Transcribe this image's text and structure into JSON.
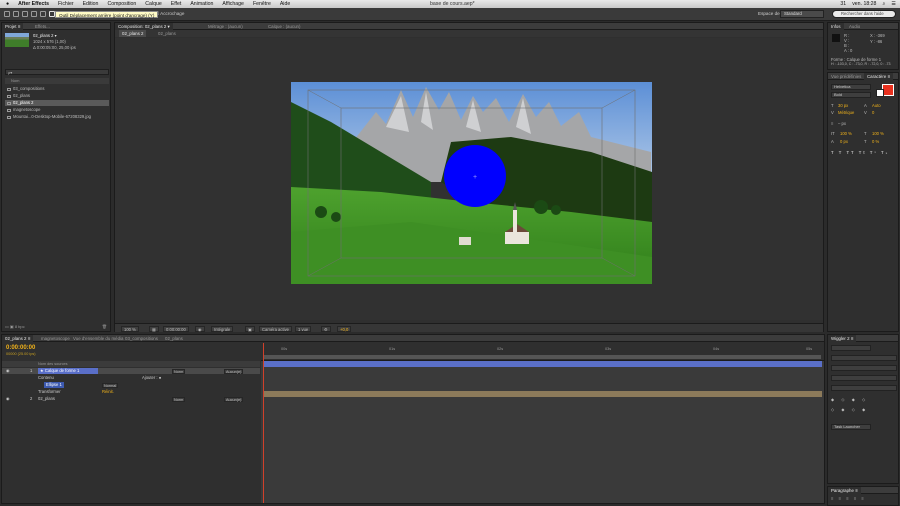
{
  "menubar": {
    "apple": "",
    "items": [
      "After Effects",
      "Fichier",
      "Edition",
      "Composition",
      "Calque",
      "Effet",
      "Animation",
      "Affichage",
      "Fenêtre",
      "Aide"
    ],
    "document_title": "base de cours.aep*",
    "clock": "ven. 18:28",
    "battery": "31"
  },
  "toolbar": {
    "tooltip": "Outil Déplacement arrière (point d'ancrage) (Y)",
    "align_label": "Accrochage",
    "workspace_label": "Espace de travail",
    "workspace_value": "Standard",
    "help_search_placeholder": "Rechercher dans l'aide"
  },
  "project_panel": {
    "tabs": [
      "Projet ≡",
      "Effets..."
    ],
    "selected_name": "02_plans 2 ▾",
    "info_line1": "1024 x 576 (1,00)",
    "info_line2": "Δ 0:00:05:00, 25,00 ips",
    "search_placeholder": "ρ▾",
    "col_header": "Nom",
    "items": [
      {
        "label": "03_compositions",
        "type": "folder",
        "selected": false
      },
      {
        "label": "02_plans",
        "type": "folder",
        "selected": false
      },
      {
        "label": "02_plans 2",
        "type": "comp",
        "selected": true
      },
      {
        "label": "magnetoscope",
        "type": "folder",
        "selected": false
      },
      {
        "label": "Mountai...0-Desktop-Mobile-67208329.jpg",
        "type": "file",
        "selected": false
      }
    ],
    "bottom_bits": "8 bpc"
  },
  "composition": {
    "tabs": [
      "Composition: 02_plans 2 ▾",
      "Métrage : (aucun)",
      "Calque : (aucun)"
    ],
    "sub_tabs": [
      "02_plans 2",
      "02_plans"
    ],
    "footer": {
      "zoom": "100 %",
      "timecode": "0:00:00:00",
      "resolution": "Intégrale",
      "camera": "Caméra active",
      "views": "1 vue",
      "offset": "+0,0"
    }
  },
  "info_panel": {
    "tabs": [
      "Infos",
      "Audio"
    ],
    "r": "R :",
    "g": "V :",
    "b": "B :",
    "a": "A : 0",
    "x": "X : -369",
    "y": "Y : -86",
    "shape_line1": "Forme : Calque de forme 1",
    "shape_line2": "H : -103,0, C : -73,0, R : -72,0, 0 : -73"
  },
  "character_panel": {
    "tabs": [
      "Vue prédéfinies",
      "Caractère ≡"
    ],
    "font_family": "Helvetica",
    "font_style": "Bold",
    "size_label": "30 px",
    "leading_label": "Auto",
    "kerning_label": "Métrique",
    "tracking_label": "0",
    "stroke_label": "– px",
    "vscale": "100 %",
    "hscale": "100 %",
    "baseline": "0 px",
    "tsume": "0 %",
    "fill_color": "#e8311f"
  },
  "wiggler_panel": {
    "tabs": [
      "Wiggler 2 ≡"
    ],
    "script_label": "Task Launcher",
    "paragraph_label": "Paragraphe ≡"
  },
  "timeline": {
    "tabs": [
      "02_plans 2 ≡",
      "magnetoscope",
      "Vue d'ensemble du média",
      "03_compositions",
      "02_plans"
    ],
    "timecode": "0:00:00:00",
    "frames": "00000 (25.00 ips)",
    "columns": "Nom des sources",
    "layers": [
      {
        "num": "1",
        "name": "★ Calque de forme 1",
        "mode": "Norm",
        "parent": "Aucun(e)",
        "selected": true
      },
      {
        "label": "Contenu",
        "add": "Ajouter : ●"
      },
      {
        "label": "Ellipse 1",
        "mode": "Normal"
      },
      {
        "label": "Transformer",
        "value": "Réinit."
      },
      {
        "num": "2",
        "name": "02_plans",
        "mode": "Norm",
        "parent": "Aucun(e)",
        "selected": false
      }
    ],
    "ruler_ticks": [
      "00s",
      "01s",
      "02s",
      "03s",
      "04s",
      "05s"
    ]
  },
  "colors": {
    "accent_orange": "#f0b21a",
    "shape_blue": "#0000ff",
    "layer_bar": "#5a6fc8",
    "layer2_bar": "#8c7a5a"
  }
}
